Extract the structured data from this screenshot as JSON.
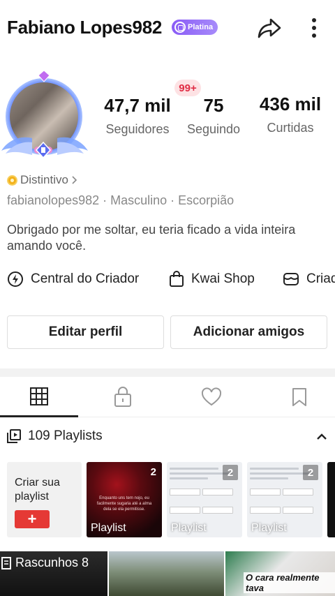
{
  "header": {
    "username": "Fabiano Lopes982",
    "badge_label": "Platina"
  },
  "stats": {
    "followers": {
      "value": "47,7 mil",
      "label": "Seguidores"
    },
    "following": {
      "value": "75",
      "label": "Seguindo"
    },
    "likes": {
      "value": "436 mil",
      "label": "Curtidas"
    },
    "notification_badge": "99+"
  },
  "profile": {
    "distinctive_label": "Distintivo",
    "meta": "fabianolopes982 · Masculino · Escorpião",
    "bio": "Obrigado por me soltar, eu teria ficado a vida inteira amando você."
  },
  "quick_links": {
    "creator_center": "Central do Criador",
    "shop": "Kwai Shop",
    "creator_partial": "Criad"
  },
  "buttons": {
    "edit_profile": "Editar perfil",
    "add_friends": "Adicionar amigos"
  },
  "tabs": [
    {
      "name": "grid",
      "icon": "grid-icon",
      "active": true
    },
    {
      "name": "private",
      "icon": "lock-icon",
      "active": false
    },
    {
      "name": "liked",
      "icon": "heart-icon",
      "active": false
    },
    {
      "name": "saved",
      "icon": "bookmark-icon",
      "active": false
    }
  ],
  "playlists": {
    "header": "109 Playlists",
    "create_label": "Criar sua playlist",
    "create_button": "+",
    "items": [
      {
        "label": "Playlist",
        "count": "2",
        "quote": "Enquanto uns tem nojo, eu facilmente sugaria até a alma dela se ela permitisse."
      },
      {
        "label": "Playlist",
        "count": "2"
      },
      {
        "label": "Playlist",
        "count": "2"
      }
    ]
  },
  "drafts": {
    "label": "Rascunhos 8"
  },
  "video_caption": "O cara realmente tava",
  "colors": {
    "accent_red": "#e53935",
    "badge_purple": "#8a5cf6",
    "notif_red": "#e02d45"
  }
}
